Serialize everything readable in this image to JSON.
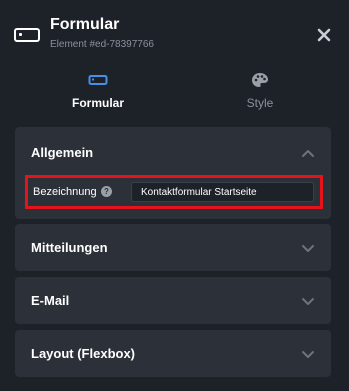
{
  "header": {
    "title": "Formular",
    "subtitle": "Element #ed-78397766",
    "element_icon": "form-element-icon",
    "close_icon": "close-icon"
  },
  "tabs": [
    {
      "label": "Formular",
      "icon": "form-icon",
      "active": true
    },
    {
      "label": "Style",
      "icon": "palette-icon",
      "active": false
    }
  ],
  "panels": {
    "allgemein": {
      "title": "Allgemein",
      "expanded": true,
      "field": {
        "label": "Bezeichnung",
        "help_icon": "help-icon",
        "value": "Kontaktformular Startseite"
      }
    },
    "mitteilungen": {
      "title": "Mitteilungen",
      "expanded": false
    },
    "email": {
      "title": "E-Mail",
      "expanded": false
    },
    "layout": {
      "title": "Layout (Flexbox)",
      "expanded": false
    }
  },
  "colors": {
    "background": "#1d2128",
    "panel": "#2b3039",
    "muted_text": "#8b929c",
    "active_accent": "#4a8fe7",
    "highlight_border": "#e5141c"
  }
}
